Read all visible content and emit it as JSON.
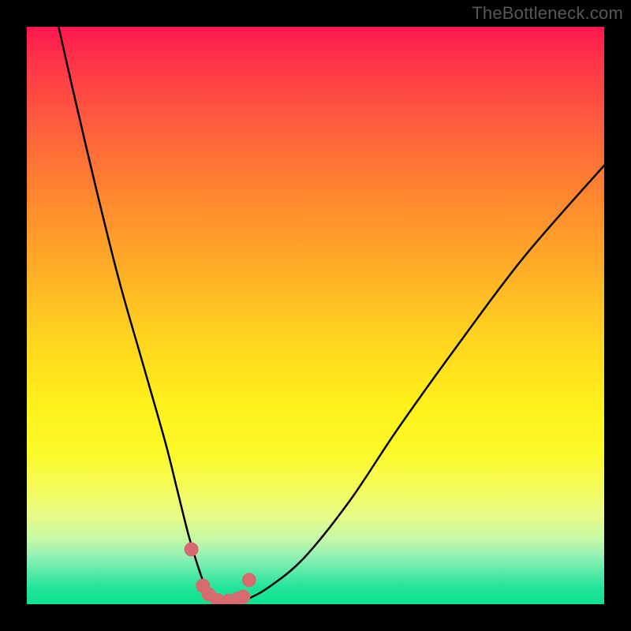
{
  "watermark": "TheBottleneck.com",
  "chart_data": {
    "type": "line",
    "title": "",
    "xlabel": "",
    "ylabel": "",
    "xlim": [
      0,
      100
    ],
    "ylim": [
      0,
      100
    ],
    "series": [
      {
        "name": "bottleneck-curve",
        "x": [
          5.5,
          8,
          12,
          16,
          20,
          24,
          26,
          28,
          29.5,
          31,
          33,
          35.5,
          37,
          38.5,
          42,
          48,
          56,
          64,
          74,
          86,
          100
        ],
        "values": [
          100,
          89,
          72,
          56,
          42,
          28,
          20,
          12,
          7,
          3,
          1,
          0.5,
          0.5,
          1,
          3,
          8,
          18,
          30,
          44,
          60,
          76
        ]
      }
    ],
    "markers": {
      "name": "highlight-points",
      "color": "#d76a6f",
      "x": [
        28.5,
        30.5,
        31.5,
        33.0,
        35.0,
        36.5,
        37.5,
        38.5
      ],
      "values": [
        9.5,
        3.2,
        1.7,
        0.7,
        0.6,
        0.9,
        1.3,
        4.2
      ]
    },
    "background": {
      "type": "vertical-gradient",
      "stops": [
        {
          "pos": 0,
          "color": "#ff1650"
        },
        {
          "pos": 50,
          "color": "#ffd41f"
        },
        {
          "pos": 80,
          "color": "#f4fb5a"
        },
        {
          "pos": 100,
          "color": "#0ee28e"
        }
      ]
    }
  }
}
